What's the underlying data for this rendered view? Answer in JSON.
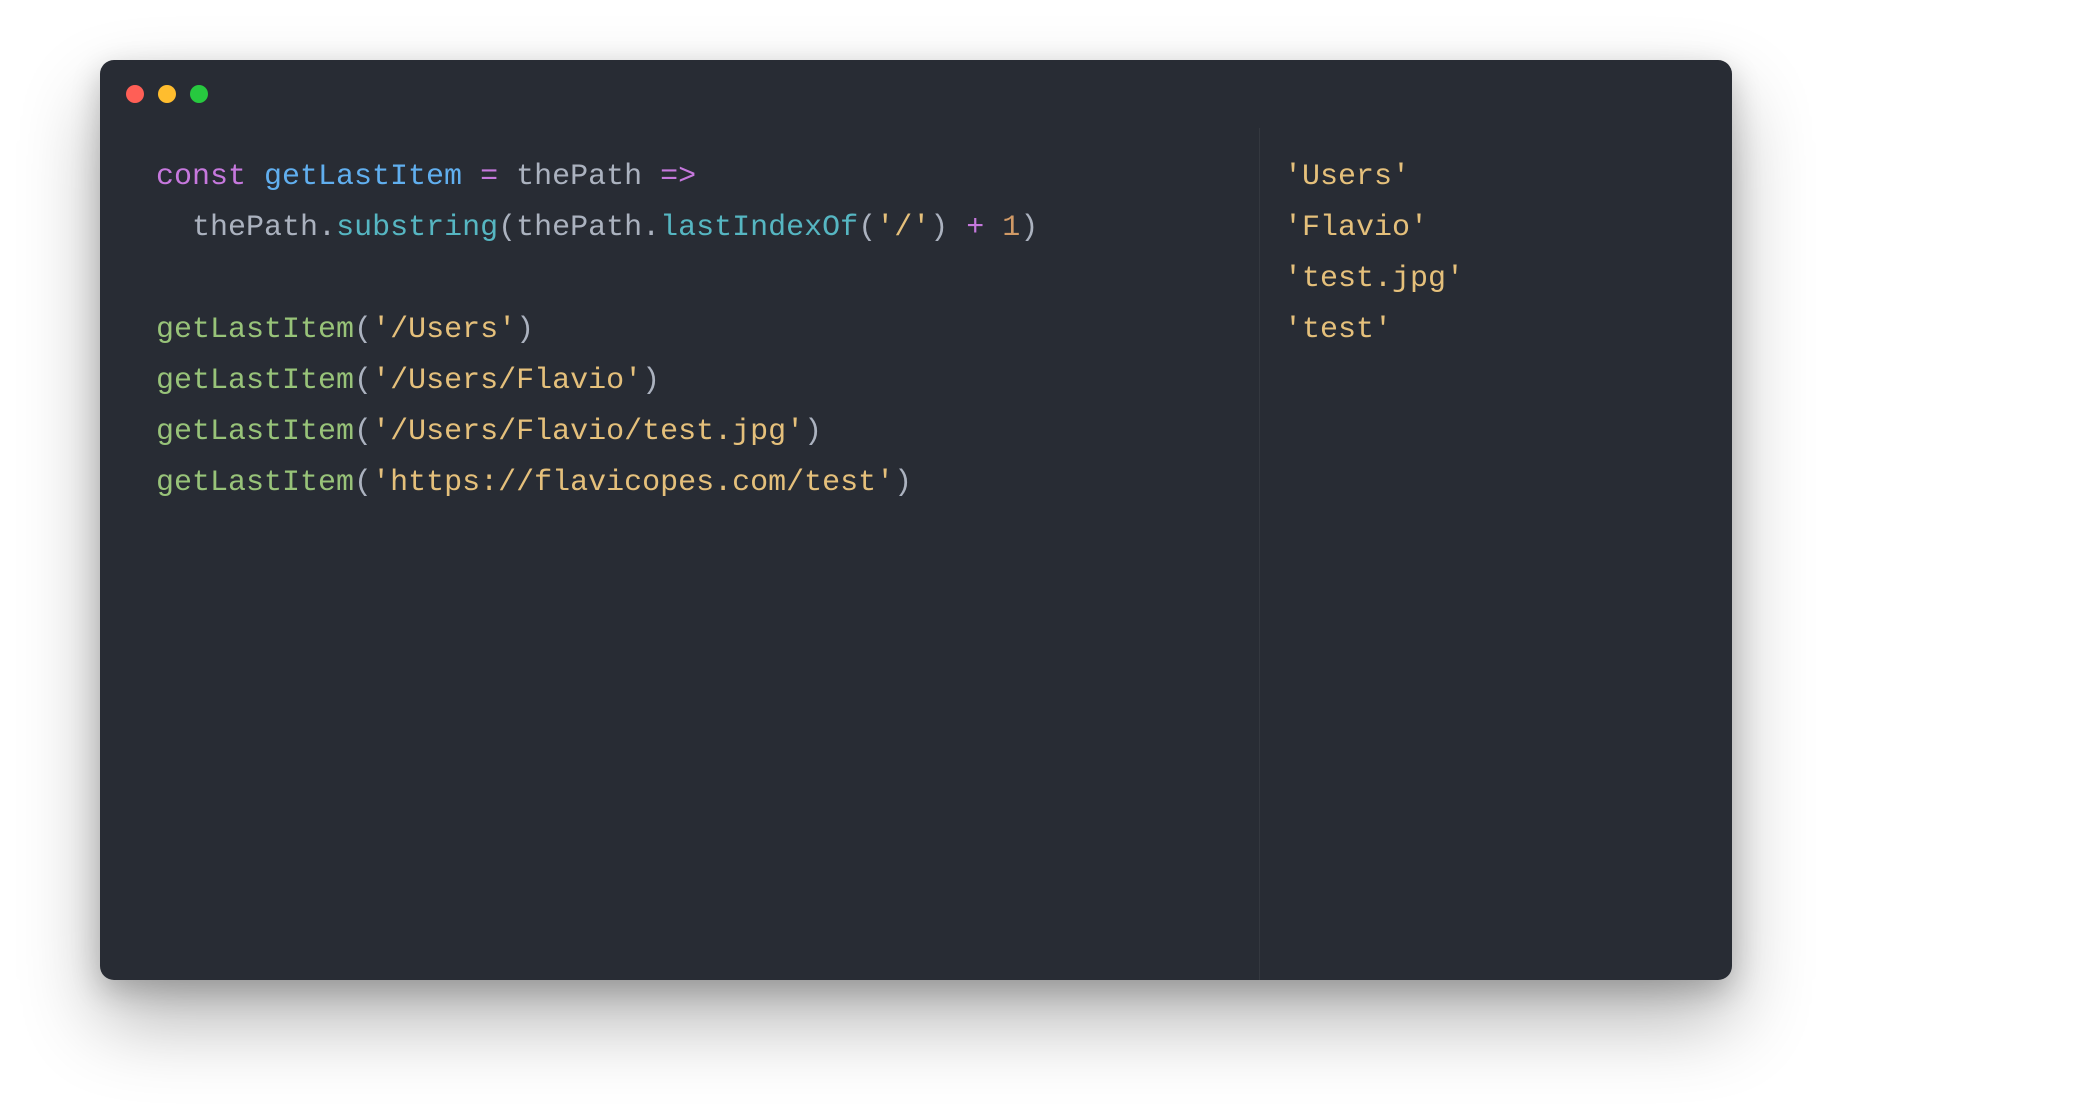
{
  "code": {
    "line1": {
      "kw_const": "const",
      "decl_name": "getLastItem",
      "eq": " = ",
      "param": "thePath",
      "arrow": " =>"
    },
    "line2": {
      "indent": "  ",
      "ident_thePath1": "thePath",
      "dot1": ".",
      "method_substring": "substring",
      "paren_open1": "(",
      "ident_thePath2": "thePath",
      "dot2": ".",
      "method_lastIndexOf": "lastIndexOf",
      "paren_open2": "(",
      "str_slash": "'/'",
      "paren_close2": ")",
      "space_plus": " ",
      "op_plus": "+",
      "space_num": " ",
      "num_one": "1",
      "paren_close1": ")"
    },
    "line3_blank": "",
    "call1": {
      "fn": "getLastItem",
      "open": "(",
      "arg": "'/Users'",
      "close": ")"
    },
    "call2": {
      "fn": "getLastItem",
      "open": "(",
      "arg": "'/Users/Flavio'",
      "close": ")"
    },
    "call3": {
      "fn": "getLastItem",
      "open": "(",
      "arg": "'/Users/Flavio/test.jpg'",
      "close": ")"
    },
    "call4": {
      "fn": "getLastItem",
      "open": "(",
      "arg": "'https://flavicopes.com/test'",
      "close": ")"
    }
  },
  "output": {
    "line1": "'Users'",
    "line2": "'Flavio'",
    "line3": "'test.jpg'",
    "line4": "'test'"
  }
}
